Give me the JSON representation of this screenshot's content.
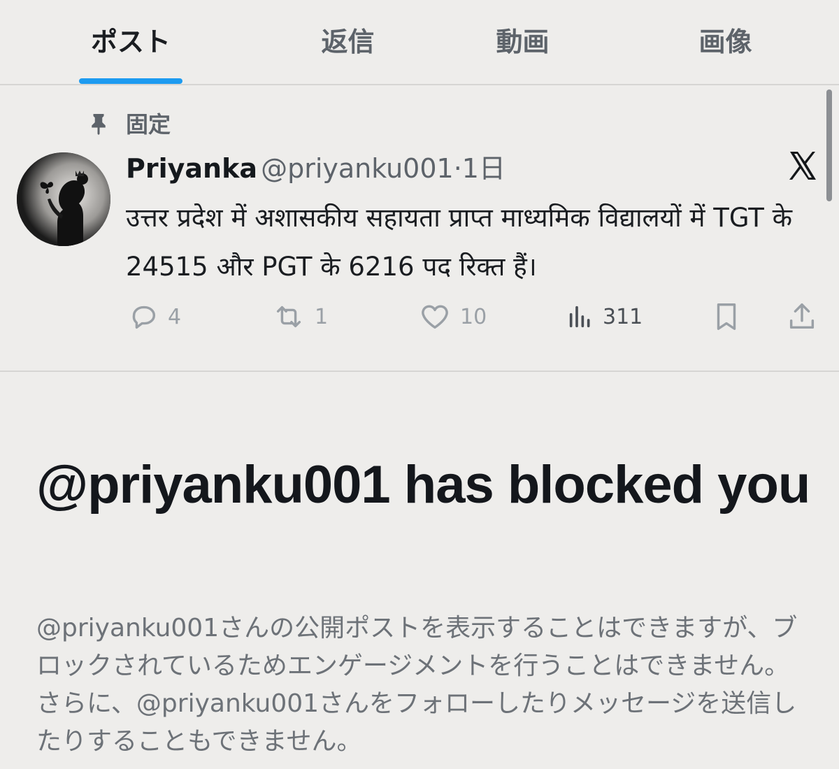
{
  "tabs": [
    {
      "label": "ポスト",
      "active": true
    },
    {
      "label": "返信",
      "active": false
    },
    {
      "label": "動画",
      "active": false
    },
    {
      "label": "画像",
      "active": false
    }
  ],
  "pinned": {
    "label": "固定",
    "icon": "pin-icon"
  },
  "post": {
    "author_name": "Priyanka",
    "author_handle": "@priyanku001",
    "timestamp": "·1日",
    "more_icon": "x-logo-icon",
    "body": "उत्तर प्रदेश में अशासकीय सहायता प्राप्त माध्यमिक विद्यालयों में TGT के 24515 और PGT के 6216 पद रिक्त हैं।",
    "actions": {
      "replies": "4",
      "reposts": "1",
      "likes": "10",
      "views": "311"
    }
  },
  "blocked": {
    "title": "@priyanku001 has blocked you",
    "description": "@priyanku001さんの公開ポストを表示することはできますが、ブロックされているためエンゲージメントを行うことはできません。さらに、@priyanku001さんをフォローしたりメッセージを送信したりすることもできません。"
  },
  "colors": {
    "accent": "#1d9bf0",
    "background": "#eeedeb",
    "muted_text": "#5d636a"
  }
}
